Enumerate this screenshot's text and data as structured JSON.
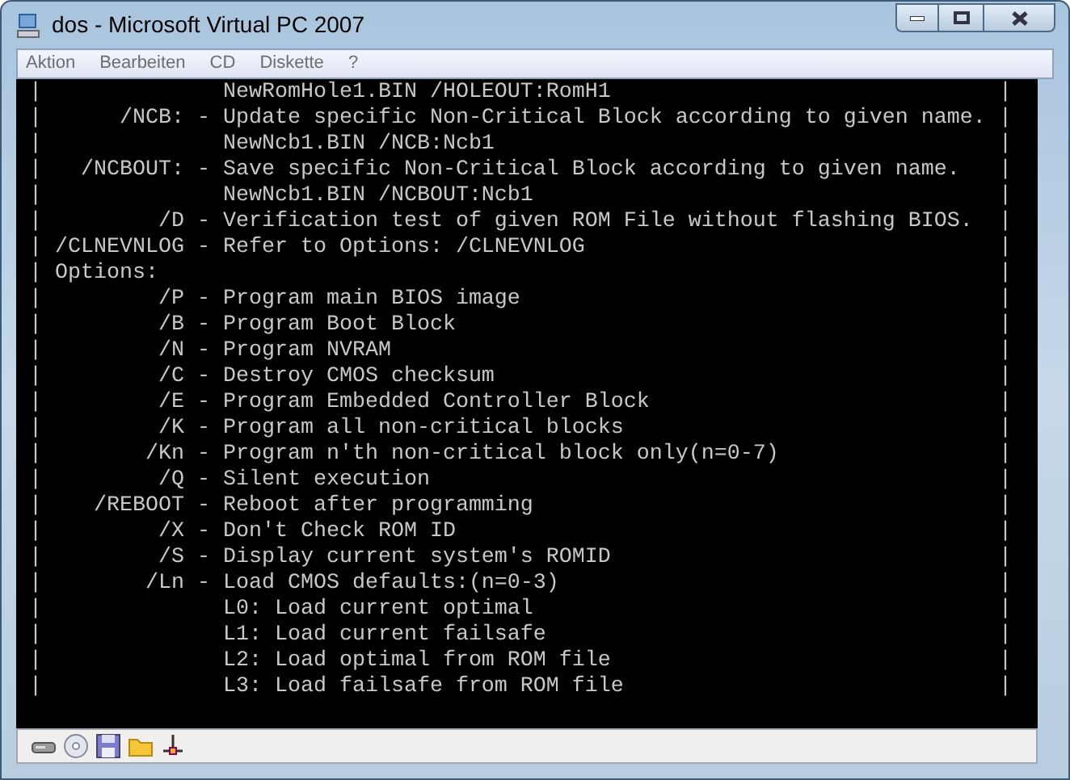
{
  "window": {
    "title": "dos - Microsoft Virtual PC 2007"
  },
  "menu": [
    {
      "label": "Aktion"
    },
    {
      "label": "Bearbeiten"
    },
    {
      "label": "CD"
    },
    {
      "label": "Diskette"
    },
    {
      "label": "?"
    }
  ],
  "console": {
    "lines": [
      {
        "text": "|              NewRomHole1.BIN /HOLEOUT:RomH1",
        "edge": "|"
      },
      {
        "text": "|      /NCB: - Update specific Non-Critical Block according to given name.",
        "edge": "|"
      },
      {
        "text": "|              NewNcb1.BIN /NCB:Ncb1",
        "edge": "|"
      },
      {
        "text": "|   /NCBOUT: - Save specific Non-Critical Block according to given name.",
        "edge": "|"
      },
      {
        "text": "|              NewNcb1.BIN /NCBOUT:Ncb1",
        "edge": "|"
      },
      {
        "text": "|         /D - Verification test of given ROM File without flashing BIOS.",
        "edge": "|"
      },
      {
        "text": "| /CLNEVNLOG - Refer to Options: /CLNEVNLOG",
        "edge": "|"
      },
      {
        "text": "| Options:",
        "edge": "|"
      },
      {
        "text": "|         /P - Program main BIOS image",
        "edge": "|"
      },
      {
        "text": "|         /B - Program Boot Block",
        "edge": "|"
      },
      {
        "text": "|         /N - Program NVRAM",
        "edge": "|"
      },
      {
        "text": "|         /C - Destroy CMOS checksum",
        "edge": "|"
      },
      {
        "text": "|         /E - Program Embedded Controller Block",
        "edge": "|"
      },
      {
        "text": "|         /K - Program all non-critical blocks",
        "edge": "|"
      },
      {
        "text": "|        /Kn - Program n'th non-critical block only(n=0-7)",
        "edge": "|"
      },
      {
        "text": "|         /Q - Silent execution",
        "edge": "|"
      },
      {
        "text": "|    /REBOOT - Reboot after programming",
        "edge": "|"
      },
      {
        "text": "|         /X - Don't Check ROM ID",
        "edge": "|"
      },
      {
        "text": "|         /S - Display current system's ROMID",
        "edge": "|"
      },
      {
        "text": "|        /Ln - Load CMOS defaults:(n=0-3)",
        "edge": "|"
      },
      {
        "text": "|              L0: Load current optimal",
        "edge": "|"
      },
      {
        "text": "|              L1: Load current failsafe",
        "edge": "|"
      },
      {
        "text": "|              L2: Load optimal from ROM file",
        "edge": "|"
      },
      {
        "text": "|              L3: Load failsafe from ROM file",
        "edge": "|"
      }
    ]
  },
  "status_bar": {
    "icons": [
      {
        "kind": "disk"
      },
      {
        "kind": "cd"
      },
      {
        "kind": "floppy"
      },
      {
        "kind": "folder"
      },
      {
        "kind": "network"
      }
    ]
  }
}
